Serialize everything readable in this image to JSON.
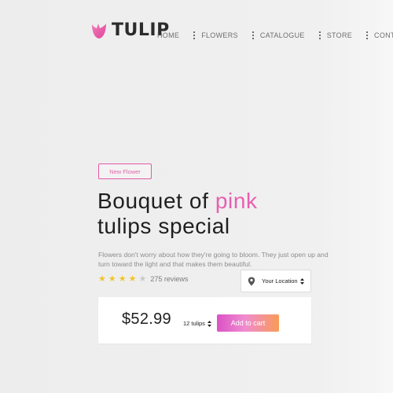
{
  "brand": {
    "name": "TULIP",
    "logo_icon": "tulip-icon",
    "logo_color": "#e85fb0"
  },
  "nav": {
    "items": [
      {
        "label": "HOME"
      },
      {
        "label": "FLOWERS"
      },
      {
        "label": "CATALOGUE"
      },
      {
        "label": "STORE"
      },
      {
        "label": "CONTACT"
      }
    ]
  },
  "hero": {
    "badge": "New Flower",
    "title_part1": "Bouquet of ",
    "title_accent": "pink",
    "title_part2": "tulips special",
    "description": "Flowers don't worry about how they're going to bloom. They just open up and turn toward the light and that makes them beautiful.",
    "rating": 4,
    "rating_max": 5,
    "reviews": "275 reviews",
    "location_label": "Your Location",
    "location_icon": "map-pin-icon"
  },
  "purchase": {
    "price": "$52.99",
    "quantity": "12 tulips",
    "add_label": "Add to cart"
  },
  "colors": {
    "accent": "#e85fb0",
    "star": "#f2c424",
    "button_gradient_start": "#db52c4",
    "button_gradient_end": "#f89b57"
  }
}
